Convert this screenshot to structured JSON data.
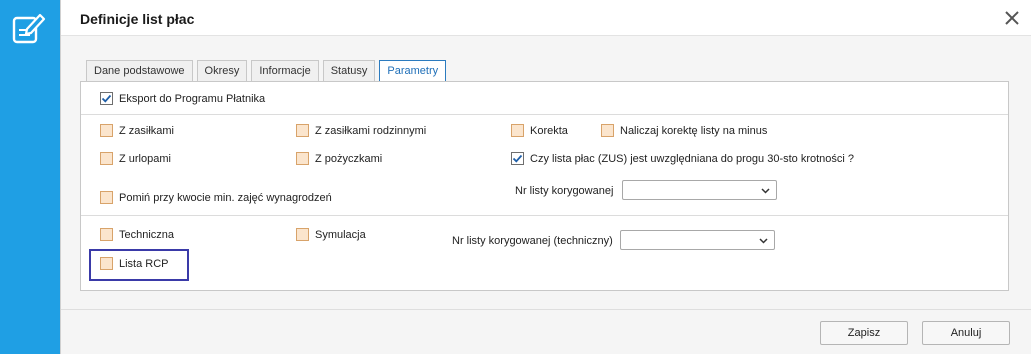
{
  "dialog": {
    "title": "Definicje list płac"
  },
  "tabs": [
    {
      "label": "Dane podstawowe",
      "active": false
    },
    {
      "label": "Okresy",
      "active": false
    },
    {
      "label": "Informacje",
      "active": false
    },
    {
      "label": "Statusy",
      "active": false
    },
    {
      "label": "Parametry",
      "active": true
    }
  ],
  "section1": {
    "export_label": "Eksport do Programu Płatnika",
    "export_checked": true
  },
  "section2": {
    "z_zasilkami": {
      "label": "Z zasiłkami",
      "checked": false
    },
    "z_zasilkami_rodzinnymi": {
      "label": "Z zasiłkami rodzinnymi",
      "checked": false
    },
    "korekta": {
      "label": "Korekta",
      "checked": false
    },
    "naliczaj_korekte": {
      "label": "Naliczaj korektę listy na minus",
      "checked": false
    },
    "z_urlopami": {
      "label": "Z urlopami",
      "checked": false
    },
    "z_pozyczkami": {
      "label": "Z pożyczkami",
      "checked": false
    },
    "czy_lista_plac": {
      "label": "Czy lista płac (ZUS) jest uwzględniana do progu 30-sto krotności ?",
      "checked": true
    },
    "pomin": {
      "label": "Pomiń przy kwocie min. zajęć wynagrodzeń",
      "checked": false
    },
    "nr_listy_korygowanej_label": "Nr listy korygowanej",
    "nr_listy_korygowanej_value": ""
  },
  "section3": {
    "techniczna": {
      "label": "Techniczna",
      "checked": false
    },
    "symulacja": {
      "label": "Symulacja",
      "checked": false
    },
    "lista_rcp": {
      "label": "Lista RCP",
      "checked": false
    },
    "nr_listy_tech_label": "Nr listy korygowanej (techniczny)",
    "nr_listy_tech_value": ""
  },
  "footer": {
    "save_label": "Zapisz",
    "cancel_label": "Anuluj"
  },
  "colors": {
    "accent": "#1f9fe4",
    "checkbox_unchecked": "#fbe5cd",
    "highlight": "#3a3aa8",
    "active_tab": "#1f6fb8"
  }
}
